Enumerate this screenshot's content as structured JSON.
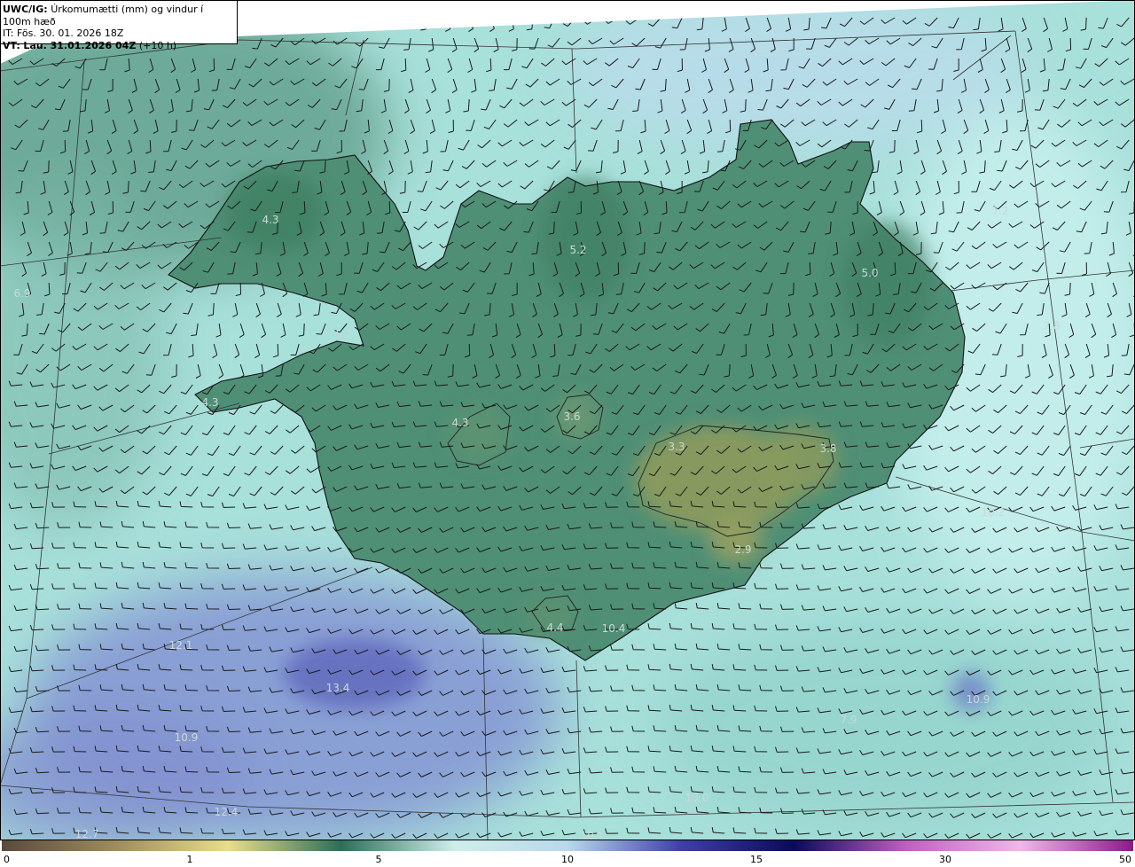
{
  "header": {
    "model_prefix": "UWC/IG:",
    "title": "Úrkomumætti (mm) og vindur í 100m hæð",
    "it_line": "IT: Fös. 30. 01. 2026 18Z",
    "vt_prefix": "VT:",
    "vt_line": "Lau. 31.01.2026 04Z",
    "lead": "(+10 h)"
  },
  "map_values": [
    {
      "label": "4.3"
    },
    {
      "label": "5.2"
    },
    {
      "label": "5.0"
    },
    {
      "label": "6.9"
    },
    {
      "label": "5.2"
    },
    {
      "label": "7.8"
    },
    {
      "label": "4.3"
    },
    {
      "label": "4.3"
    },
    {
      "label": "3.6"
    },
    {
      "label": "3.3"
    },
    {
      "label": "3.8"
    },
    {
      "label": "10.2"
    },
    {
      "label": "2.9"
    },
    {
      "label": "4.4"
    },
    {
      "label": "10.4"
    },
    {
      "label": "12.1"
    },
    {
      "label": "13.4"
    },
    {
      "label": "7.9"
    },
    {
      "label": "10.9"
    },
    {
      "label": "10.9"
    },
    {
      "label": "10.0"
    },
    {
      "label": "12.4"
    },
    {
      "label": "12.7"
    },
    {
      "label": "10.1"
    },
    {
      "label": "7.2"
    }
  ],
  "colorbar": {
    "ticks": [
      "0",
      "1",
      "5",
      "10",
      "15",
      "30",
      "50"
    ],
    "stops": [
      "#5a4a3c",
      "#9c8c5e",
      "#e8de8c",
      "#2d6e58",
      "#cfeeea",
      "#b8d8ec",
      "#3f3fa8",
      "#0a0a5a",
      "#c060c0",
      "#f0b8e8",
      "#8a1a8a"
    ]
  },
  "colors": {
    "land": "#4f8f76",
    "land_high": "#8a9a5e",
    "sea": "#a8e0da",
    "heavy": "#6a7ccc"
  }
}
